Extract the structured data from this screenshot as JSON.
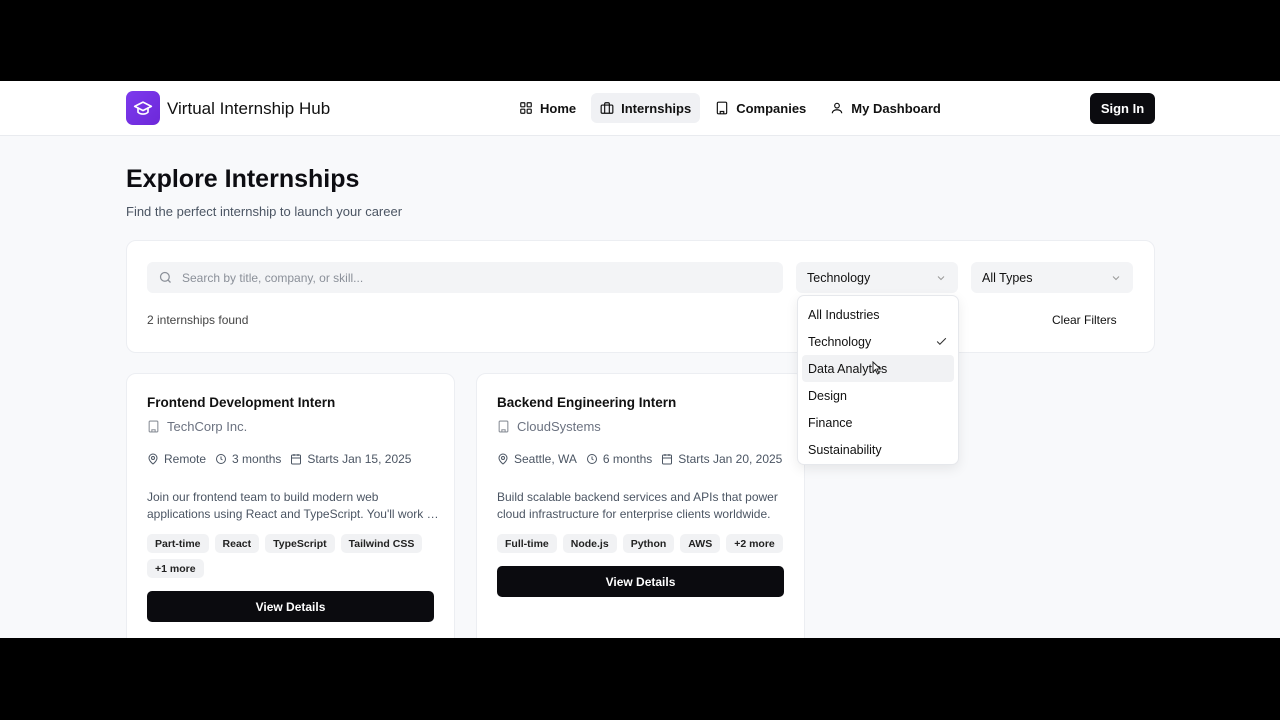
{
  "header": {
    "brand": "Virtual Internship Hub",
    "nav": [
      {
        "label": "Home",
        "icon": "grid-icon"
      },
      {
        "label": "Internships",
        "icon": "briefcase-icon",
        "active": true
      },
      {
        "label": "Companies",
        "icon": "building-icon"
      },
      {
        "label": "My Dashboard",
        "icon": "user-icon"
      }
    ],
    "signin_label": "Sign In",
    "accent": "#7c3aed"
  },
  "page": {
    "title": "Explore Internships",
    "subtitle": "Find the perfect internship to launch your career"
  },
  "filters": {
    "search_placeholder": "Search by title, company, or skill...",
    "industry_selected": "Technology",
    "type_selected": "All Types",
    "count_text": "2 internships found",
    "clear_label": "Clear Filters"
  },
  "industry_dropdown": {
    "options": [
      "All Industries",
      "Technology",
      "Data Analytics",
      "Design",
      "Finance",
      "Sustainability"
    ],
    "checked": "Technology",
    "hovered": "Data Analytics"
  },
  "internships": [
    {
      "title": "Frontend Development Intern",
      "company": "TechCorp Inc.",
      "location": "Remote",
      "duration": "3 months",
      "start": "Starts Jan 15, 2025",
      "desc_line1": "Join our frontend team to build modern web",
      "desc_line2": "applications using React and TypeScript. You'll work o...",
      "tags": [
        "Part-time",
        "React",
        "TypeScript",
        "Tailwind CSS",
        "+1 more"
      ],
      "button": "View Details"
    },
    {
      "title": "Backend Engineering Intern",
      "company": "CloudSystems",
      "location": "Seattle, WA",
      "duration": "6 months",
      "start": "Starts Jan 20, 2025",
      "desc_line1": "Build scalable backend services and APIs that power",
      "desc_line2": "cloud infrastructure for enterprise clients worldwide.",
      "tags": [
        "Full-time",
        "Node.js",
        "Python",
        "AWS",
        "+2 more"
      ],
      "button": "View Details"
    }
  ]
}
